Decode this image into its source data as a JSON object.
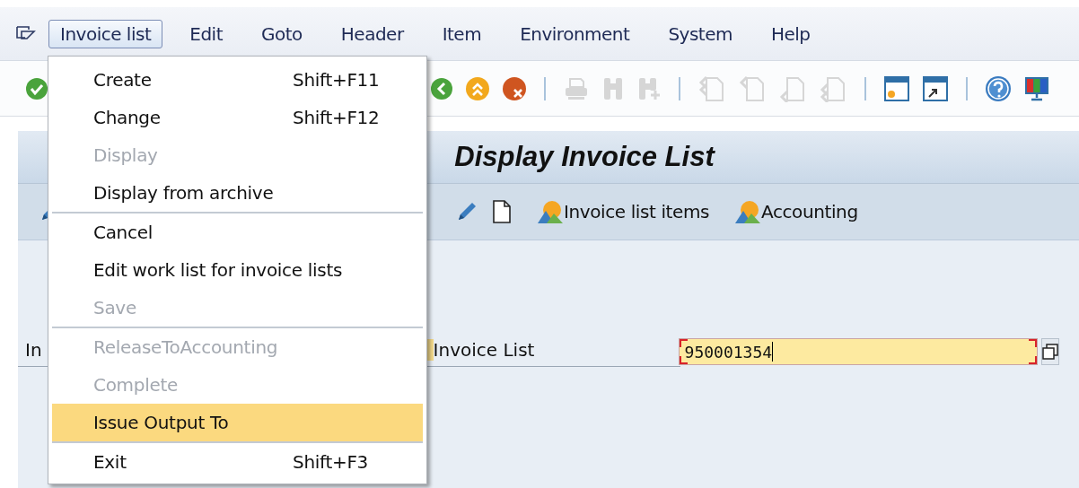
{
  "menubar": {
    "items": [
      {
        "label": "Invoice list",
        "selected": true
      },
      {
        "label": "Edit",
        "selected": false
      },
      {
        "label": "Goto",
        "selected": false
      },
      {
        "label": "Header",
        "selected": false
      },
      {
        "label": "Item",
        "selected": false
      },
      {
        "label": "Environment",
        "selected": false
      },
      {
        "label": "System",
        "selected": false
      },
      {
        "label": "Help",
        "selected": false
      }
    ]
  },
  "toolbar": {
    "buttons": [
      {
        "kind": "check",
        "disabled": false
      },
      {
        "kind": "back",
        "disabled": false
      },
      {
        "kind": "exit",
        "disabled": false
      },
      {
        "kind": "cancel",
        "disabled": false
      },
      {
        "kind": "separator"
      },
      {
        "kind": "print",
        "disabled": true
      },
      {
        "kind": "find",
        "disabled": true
      },
      {
        "kind": "findnext",
        "disabled": true
      },
      {
        "kind": "separator"
      },
      {
        "kind": "first",
        "disabled": true
      },
      {
        "kind": "prev",
        "disabled": true
      },
      {
        "kind": "next",
        "disabled": true
      },
      {
        "kind": "last",
        "disabled": true
      },
      {
        "kind": "separator"
      },
      {
        "kind": "session",
        "disabled": false
      },
      {
        "kind": "shortcut",
        "disabled": false
      },
      {
        "kind": "separator"
      },
      {
        "kind": "help",
        "disabled": false
      },
      {
        "kind": "monitor",
        "disabled": false
      }
    ]
  },
  "title": "Display Invoice List",
  "app_toolbar": {
    "items": [
      {
        "kind": "pencil"
      },
      {
        "kind": "pencil"
      },
      {
        "kind": "page"
      },
      {
        "kind": "mountain",
        "label": "Invoice list items"
      },
      {
        "kind": "mountain",
        "label": "Accounting"
      }
    ]
  },
  "form": {
    "label_cut": "In",
    "label": "Invoice List",
    "value": "950001354",
    "required": true
  },
  "menu": {
    "items": [
      {
        "kind": "item",
        "label": "Create",
        "shortcut": "Shift+F11",
        "disabled": false,
        "selected": false
      },
      {
        "kind": "item",
        "label": "Change",
        "shortcut": "Shift+F12",
        "disabled": false,
        "selected": false
      },
      {
        "kind": "item",
        "label": "Display",
        "disabled": true,
        "selected": false
      },
      {
        "kind": "item",
        "label": "Display from archive",
        "disabled": false,
        "selected": false
      },
      {
        "kind": "separator"
      },
      {
        "kind": "item",
        "label": "Cancel",
        "disabled": false,
        "selected": false
      },
      {
        "kind": "item",
        "label": "Edit work list for invoice lists",
        "disabled": false,
        "selected": false
      },
      {
        "kind": "item",
        "label": "Save",
        "disabled": true,
        "selected": false
      },
      {
        "kind": "separator"
      },
      {
        "kind": "item",
        "label": "ReleaseToAccounting",
        "disabled": true,
        "selected": false
      },
      {
        "kind": "item",
        "label": "Complete",
        "disabled": true,
        "selected": false
      },
      {
        "kind": "item",
        "label": "Issue Output To",
        "disabled": false,
        "selected": true
      },
      {
        "kind": "separator"
      },
      {
        "kind": "item",
        "label": "Exit",
        "shortcut": "Shift+F3",
        "disabled": false,
        "selected": false
      }
    ]
  }
}
